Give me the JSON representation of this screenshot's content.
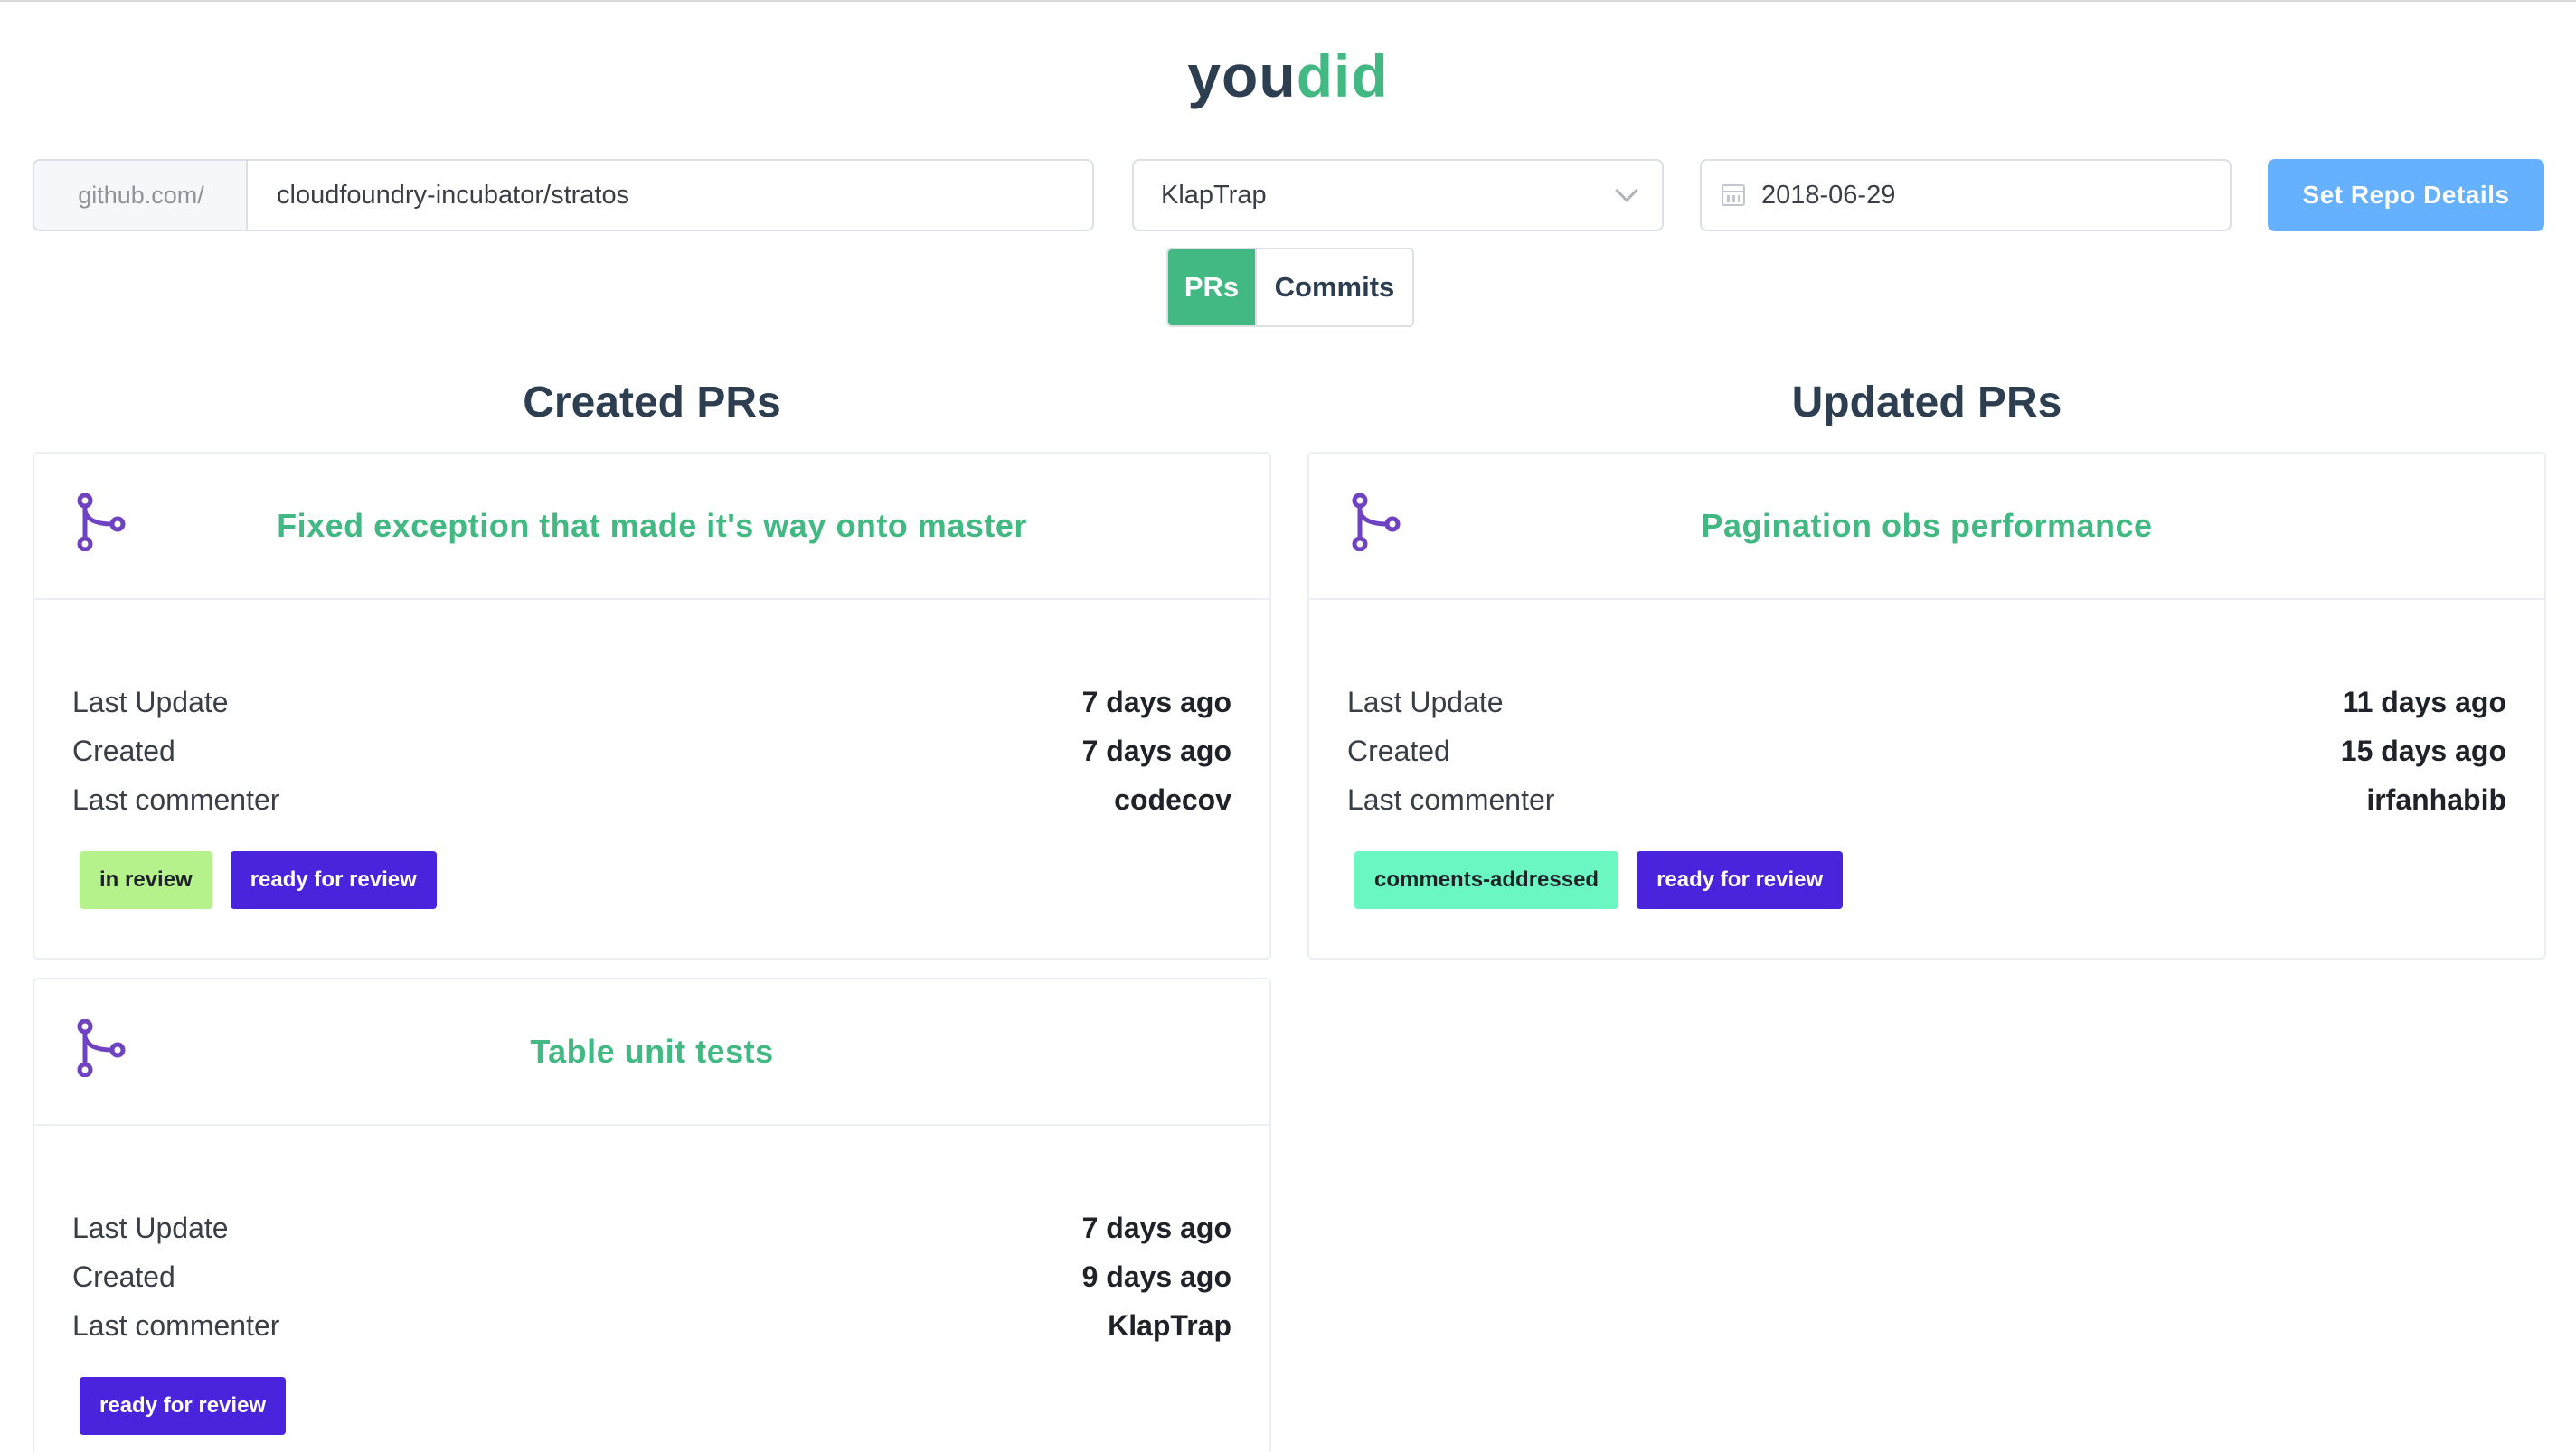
{
  "logo": {
    "part1": "you",
    "part2": "did"
  },
  "controls": {
    "repo_prefix": "github.com/",
    "repo_value": "cloudfoundry-incubator/stratos",
    "user_value": "KlapTrap",
    "date_value": "2018-06-29",
    "set_button": "Set Repo Details"
  },
  "tabs": [
    {
      "label": "PRs",
      "active": true
    },
    {
      "label": "Commits",
      "active": false
    }
  ],
  "columns": {
    "created_title": "Created PRs",
    "updated_title": "Updated PRs"
  },
  "labels": {
    "last_update": "Last Update",
    "created": "Created",
    "last_commenter": "Last commenter"
  },
  "created_prs": [
    {
      "title": "Fixed exception that made it's way onto master",
      "last_update": "7 days ago",
      "created": "7 days ago",
      "last_commenter": "codecov",
      "tags": [
        {
          "label": "in review",
          "bg": "#b6f28b",
          "fg": "#1f2329"
        },
        {
          "label": "ready for review",
          "bg": "#4a23dc",
          "fg": "#ffffff"
        }
      ]
    },
    {
      "title": "Table unit tests",
      "last_update": "7 days ago",
      "created": "9 days ago",
      "last_commenter": "KlapTrap",
      "tags": [
        {
          "label": "ready for review",
          "bg": "#4a23dc",
          "fg": "#ffffff"
        }
      ]
    }
  ],
  "updated_prs": [
    {
      "title": "Pagination obs performance",
      "last_update": "11 days ago",
      "created": "15 days ago",
      "last_commenter": "irfanhabib",
      "tags": [
        {
          "label": "comments-addressed",
          "bg": "#6af7c2",
          "fg": "#1f2329"
        },
        {
          "label": "ready for review",
          "bg": "#4a23dc",
          "fg": "#ffffff"
        }
      ]
    }
  ],
  "colors": {
    "accent": "#42b983",
    "primary_button": "#66b1ff",
    "pr_icon": "#6f42c1"
  },
  "icons": {
    "pr": "git-pull-request-icon",
    "calendar": "calendar-icon",
    "dropdown": "chevron-down-icon"
  }
}
